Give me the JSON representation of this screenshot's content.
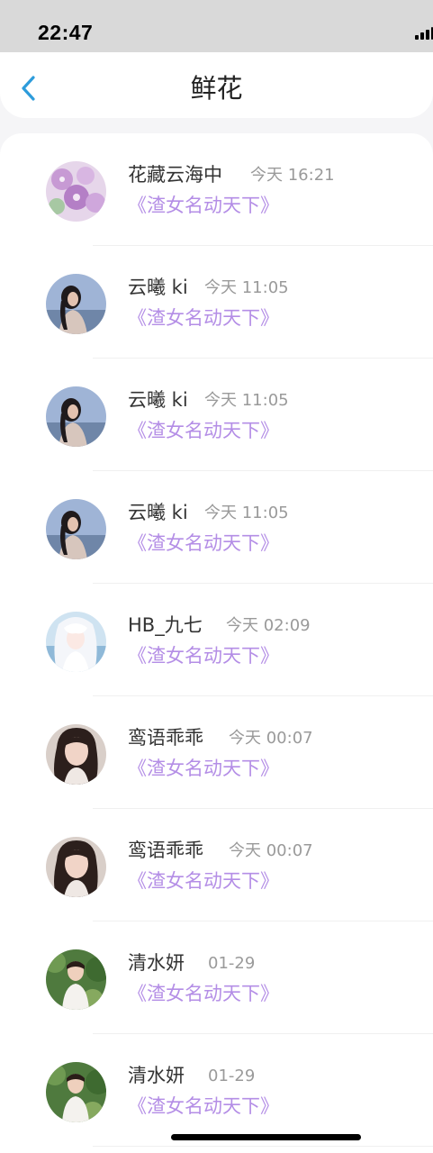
{
  "status_bar": {
    "time": "22:47"
  },
  "header": {
    "back_icon": "chevron-left-icon",
    "title": "鲜花"
  },
  "colors": {
    "gift_text": "#b48ee6",
    "accent": "#2d9cdb"
  },
  "list": [
    {
      "name": "花藏云海中",
      "time": "今天 16:21",
      "gift": "《渣女名动天下》",
      "avatar": "flower-avatar"
    },
    {
      "name": "云曦 ki",
      "time": "今天 11:05",
      "gift": "《渣女名动天下》",
      "avatar": "girl-sea-avatar"
    },
    {
      "name": "云曦 ki",
      "time": "今天 11:05",
      "gift": "《渣女名动天下》",
      "avatar": "girl-sea-avatar"
    },
    {
      "name": "云曦 ki",
      "time": "今天 11:05",
      "gift": "《渣女名动天下》",
      "avatar": "girl-sea-avatar"
    },
    {
      "name": "HB_九七",
      "time": "今天 02:09",
      "gift": "《渣女名动天下》",
      "avatar": "anime-girl-avatar"
    },
    {
      "name": "鸾语乖乖",
      "time": "今天 00:07",
      "gift": "《渣女名动天下》",
      "avatar": "girl-portrait-avatar"
    },
    {
      "name": "鸾语乖乖",
      "time": "今天 00:07",
      "gift": "《渣女名动天下》",
      "avatar": "girl-portrait-avatar"
    },
    {
      "name": "清水妍",
      "time": "01-29",
      "gift": "《渣女名动天下》",
      "avatar": "boy-garden-avatar"
    },
    {
      "name": "清水妍",
      "time": "01-29",
      "gift": "《渣女名动天下》",
      "avatar": "boy-garden-avatar"
    }
  ]
}
